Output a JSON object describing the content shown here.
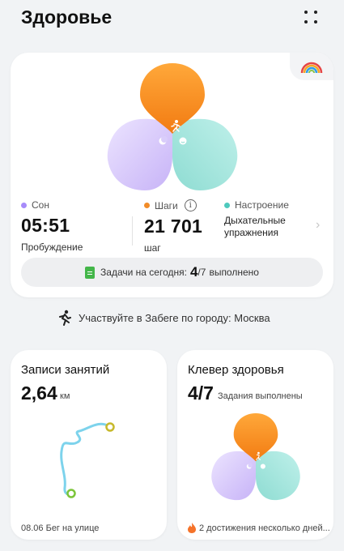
{
  "header": {
    "title": "Здоровье"
  },
  "summary": {
    "sleep": {
      "label": "Сон",
      "value": "05:51",
      "sub": "Пробуждение",
      "color": "#a78bfa"
    },
    "steps": {
      "label": "Шаги",
      "value": "21 701",
      "sub": "шаг",
      "color": "#f28c28"
    },
    "mood": {
      "label": "Настроение",
      "value": "Дыхательные упражнения",
      "color": "#4ec9bd"
    },
    "tasks": {
      "prefix": "Задачи на сегодня:",
      "done": "4",
      "total": "/7",
      "suffix": "выполнено"
    }
  },
  "promo": {
    "text": "Участвуйте в Забеге по городу: Москва"
  },
  "activity_card": {
    "title": "Записи занятий",
    "distance": "2,64",
    "unit": "км",
    "date": "08.06",
    "activity": "Бег на улице"
  },
  "clover_card": {
    "title": "Клевер здоровья",
    "score": "4/7",
    "status": "Задания выполнены",
    "achievement": "2 достижения несколько дней..."
  }
}
